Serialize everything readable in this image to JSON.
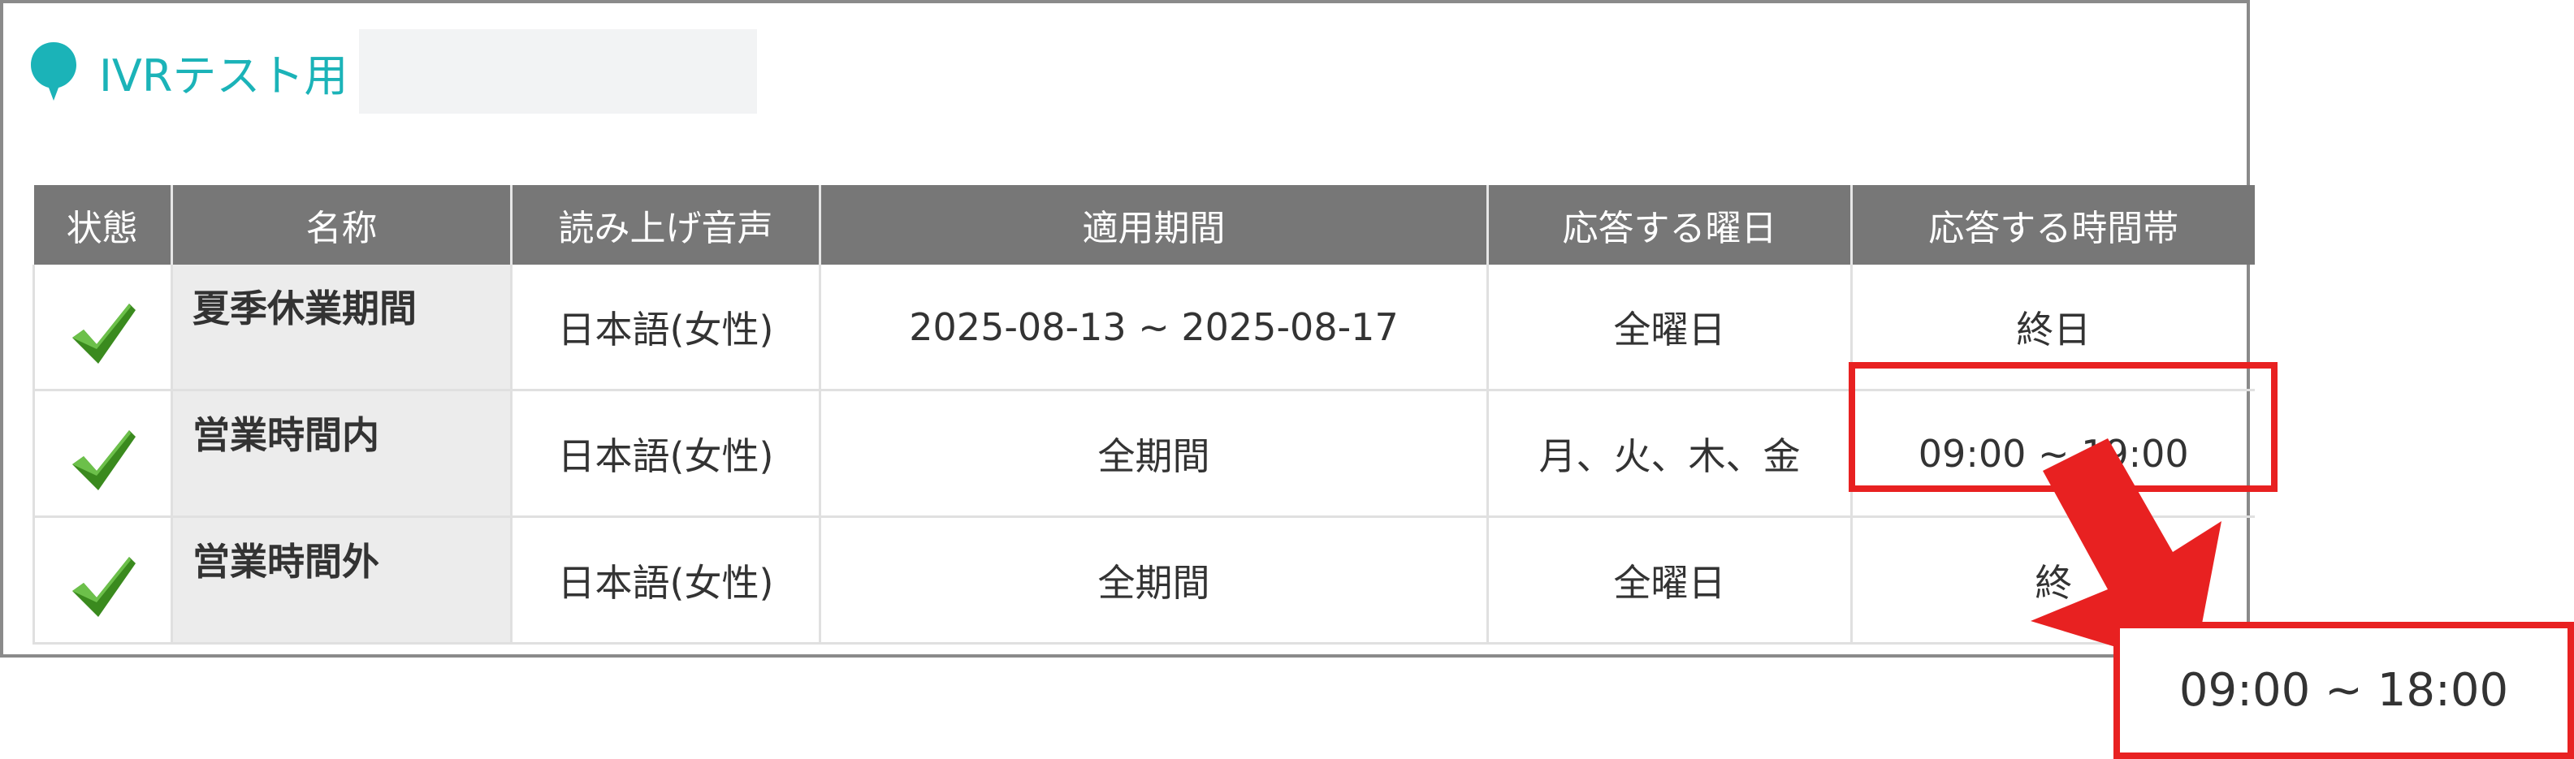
{
  "heading": {
    "title": "IVRテスト用"
  },
  "table": {
    "headers": {
      "status": "状態",
      "name": "名称",
      "voice": "読み上げ音声",
      "period": "適用期間",
      "days": "応答する曜日",
      "hours": "応答する時間帯"
    },
    "rows": [
      {
        "status_icon": "checkmark-icon",
        "name": "夏季休業期間",
        "voice": "日本語(女性)",
        "period": "2025-08-13 ~ 2025-08-17",
        "days": "全曜日",
        "hours": "終日"
      },
      {
        "status_icon": "checkmark-icon",
        "name": "営業時間内",
        "voice": "日本語(女性)",
        "period": "全期間",
        "days": "月、火、木、金",
        "hours": "09:00 ~ 19:00"
      },
      {
        "status_icon": "checkmark-icon",
        "name": "営業時間外",
        "voice": "日本語(女性)",
        "period": "全期間",
        "days": "全曜日",
        "hours": "終"
      }
    ]
  },
  "annotation": {
    "callout_text": "09:00 ~ 18:00",
    "color": "#e82121"
  },
  "colors": {
    "accent": "#1bb3b8",
    "header_bg": "#777777",
    "check_green": "#3a8a1e"
  }
}
